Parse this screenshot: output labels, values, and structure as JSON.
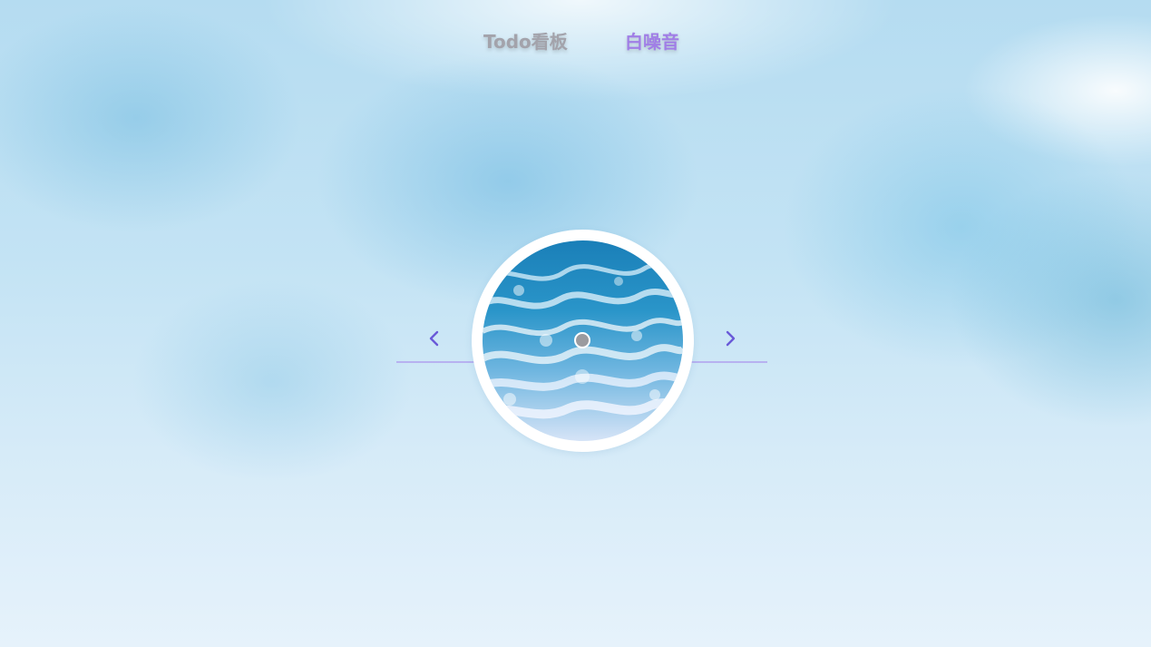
{
  "nav": {
    "tabs": [
      {
        "label": "Todo看板",
        "active": false
      },
      {
        "label": "白噪音",
        "active": true
      }
    ]
  },
  "player": {
    "prev_icon": "chevron-left-icon",
    "next_icon": "chevron-right-icon",
    "cover_icon": "ocean-waves-image",
    "center_icon": "disc-center-dot"
  },
  "colors": {
    "active_tab": "#a07ee6",
    "inactive_tab": "#a3a3ab",
    "arrow": "#6a5ad8",
    "track_line": "#b7b2f0"
  }
}
